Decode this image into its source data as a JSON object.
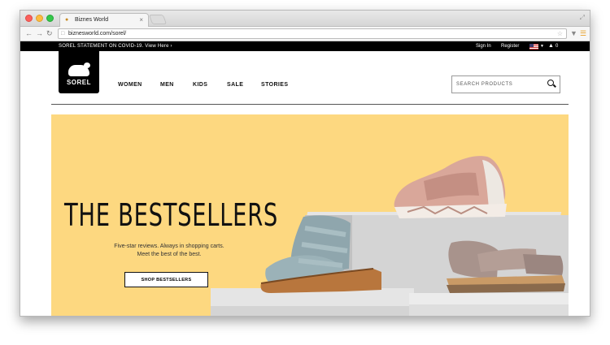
{
  "browser": {
    "tab_title": "Biznes World",
    "url": "biznesworld.com/sorel/"
  },
  "site": {
    "announcement": "SOREL STATEMENT ON COVID-19. View Here ›",
    "sign_in": "Sign In",
    "register": "Register",
    "cart_count": "0",
    "logo_text": "SOREL",
    "nav": [
      "WOMEN",
      "MEN",
      "KIDS",
      "SALE",
      "STORIES"
    ],
    "search_placeholder": "SEARCH PRODUCTS"
  },
  "hero": {
    "title": "THE BESTSELLERS",
    "subtitle_line1": "Five-star reviews. Always in shopping carts.",
    "subtitle_line2": "Meet the best of the best.",
    "cta": "SHOP BESTSELLERS",
    "background_color": "#fdd880"
  }
}
